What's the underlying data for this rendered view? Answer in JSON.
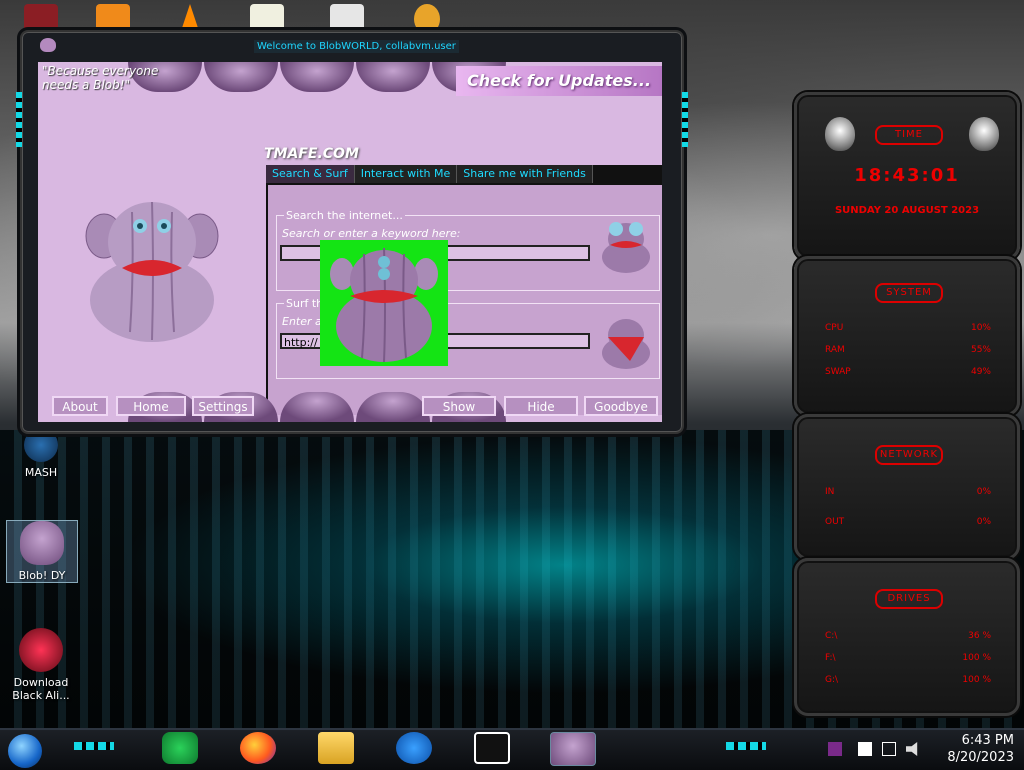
{
  "window": {
    "title": "Welcome to BlobWORLD, collabvm.user",
    "slogan": "\"Because everyone needs a Blob!\"",
    "check_updates": "Check for Updates...",
    "brand": "TMAFE.COM",
    "tabs": [
      "Search & Surf",
      "Interact with Me",
      "Share me with Friends"
    ],
    "search": {
      "label": "Search the internet...",
      "hint": "Search or enter a keyword here:",
      "value": ""
    },
    "surf": {
      "label": "Surf the",
      "hint": "Enter a",
      "value": "http://"
    },
    "buttons": {
      "about": "About",
      "home": "Home",
      "settings": "Settings",
      "show": "Show",
      "hide": "Hide",
      "goodbye": "Goodbye"
    }
  },
  "desktop_icons": [
    {
      "label": "MASH"
    },
    {
      "label": "Blob! DY"
    },
    {
      "label": "Download Black Ali..."
    }
  ],
  "gadgets": {
    "time": {
      "title": "TIME",
      "clock": "18:43:01",
      "date": "SUNDAY 20 AUGUST 2023"
    },
    "system": {
      "title": "SYSTEM",
      "rows": [
        {
          "label": "CPU",
          "value": "10%"
        },
        {
          "label": "RAM",
          "value": "55%"
        },
        {
          "label": "SWAP",
          "value": "49%"
        }
      ]
    },
    "network": {
      "title": "NETWORK",
      "rows": [
        {
          "label": "IN",
          "value": "0%"
        },
        {
          "label": "OUT",
          "value": "0%"
        }
      ]
    },
    "drives": {
      "title": "DRIVES",
      "rows": [
        {
          "label": "C:\\",
          "value": "36 %"
        },
        {
          "label": "F:\\",
          "value": "100 %"
        },
        {
          "label": "G:\\",
          "value": "100 %"
        }
      ]
    }
  },
  "taskbar": {
    "time": "6:43 PM",
    "date": "8/20/2023",
    "apps": [
      "spotify-icon",
      "firefox-icon",
      "file-explorer-icon",
      "internet-explorer-icon",
      "7zip-icon",
      "blob-app-icon"
    ]
  },
  "colors": {
    "accent_cyan": "#14d9e6",
    "gadget_red": "#e00000",
    "blob_purple": "#c7a3cf",
    "overlay_green": "#14e414"
  }
}
